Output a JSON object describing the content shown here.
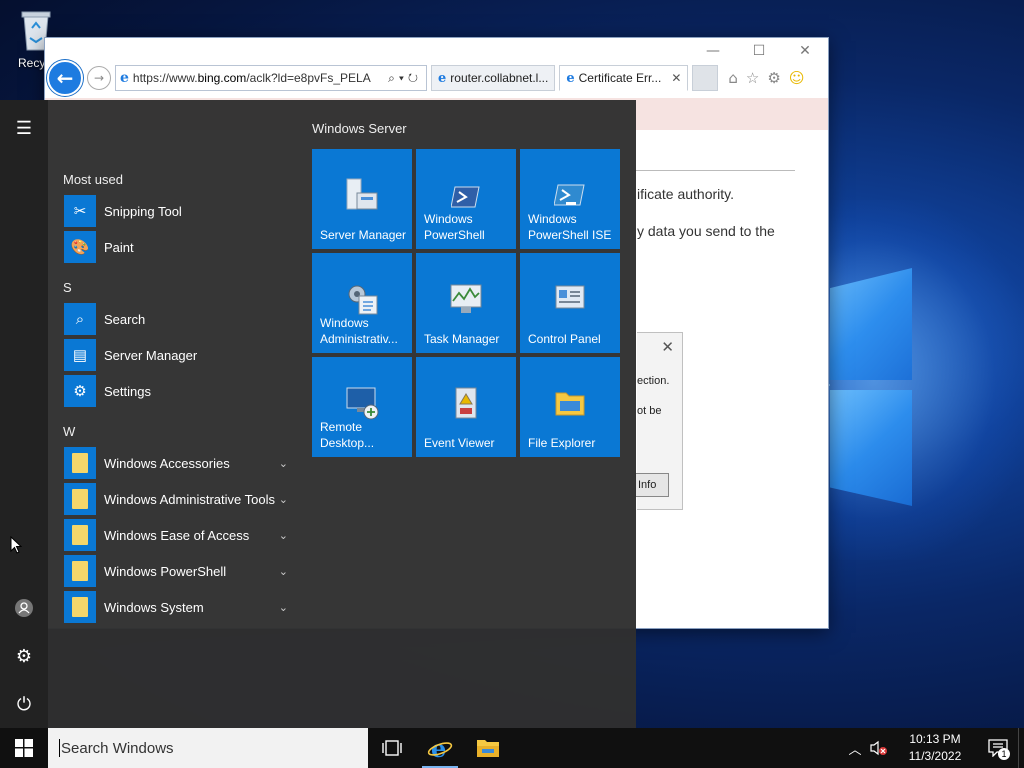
{
  "desktop": {
    "recycle_label": "Recycl"
  },
  "browser": {
    "address_prefix": "https://www.",
    "address_domain": "bing.com",
    "address_rest": "/aclk?ld=e8pvFs_PELA",
    "tabs": [
      {
        "label": "router.collabnet.l..."
      },
      {
        "label": "Certificate Err...",
        "close": "✕"
      }
    ],
    "content": {
      "line1": "ificate authority.",
      "line2": "y data you send to the"
    },
    "dialog": {
      "line1": "ection.",
      "line2": "ot be",
      "button": "Info"
    }
  },
  "start_menu": {
    "most_used_header": "Most used",
    "most_used": [
      {
        "label": "Snipping Tool",
        "icon": "scissors-icon"
      },
      {
        "label": "Paint",
        "icon": "palette-icon"
      }
    ],
    "s_header": "S",
    "s_items": [
      {
        "label": "Search",
        "icon": "search-icon"
      },
      {
        "label": "Server Manager",
        "icon": "server-icon"
      },
      {
        "label": "Settings",
        "icon": "gear-icon"
      }
    ],
    "w_header": "W",
    "w_items": [
      {
        "label": "Windows Accessories"
      },
      {
        "label": "Windows Administrative Tools"
      },
      {
        "label": "Windows Ease of Access"
      },
      {
        "label": "Windows PowerShell"
      },
      {
        "label": "Windows System"
      }
    ],
    "tiles_header": "Windows Server",
    "tiles": [
      {
        "label": "Server Manager",
        "icon": "server-manager-icon"
      },
      {
        "label": "Windows PowerShell",
        "icon": "powershell-icon"
      },
      {
        "label": "Windows PowerShell ISE",
        "icon": "powershell-ise-icon"
      },
      {
        "label": "Windows Administrativ...",
        "icon": "admin-tools-icon"
      },
      {
        "label": "Task Manager",
        "icon": "task-manager-icon"
      },
      {
        "label": "Control Panel",
        "icon": "control-panel-icon"
      },
      {
        "label": "Remote Desktop...",
        "icon": "remote-desktop-icon"
      },
      {
        "label": "Event Viewer",
        "icon": "event-viewer-icon"
      },
      {
        "label": "File Explorer",
        "icon": "folder-icon"
      }
    ]
  },
  "taskbar": {
    "search_placeholder": "Search Windows",
    "time": "10:13 PM",
    "date": "11/3/2022",
    "notification_count": "1"
  },
  "colors": {
    "accent": "#0a78d4",
    "start_bg": "#303030",
    "taskbar_bg": "#101010"
  }
}
